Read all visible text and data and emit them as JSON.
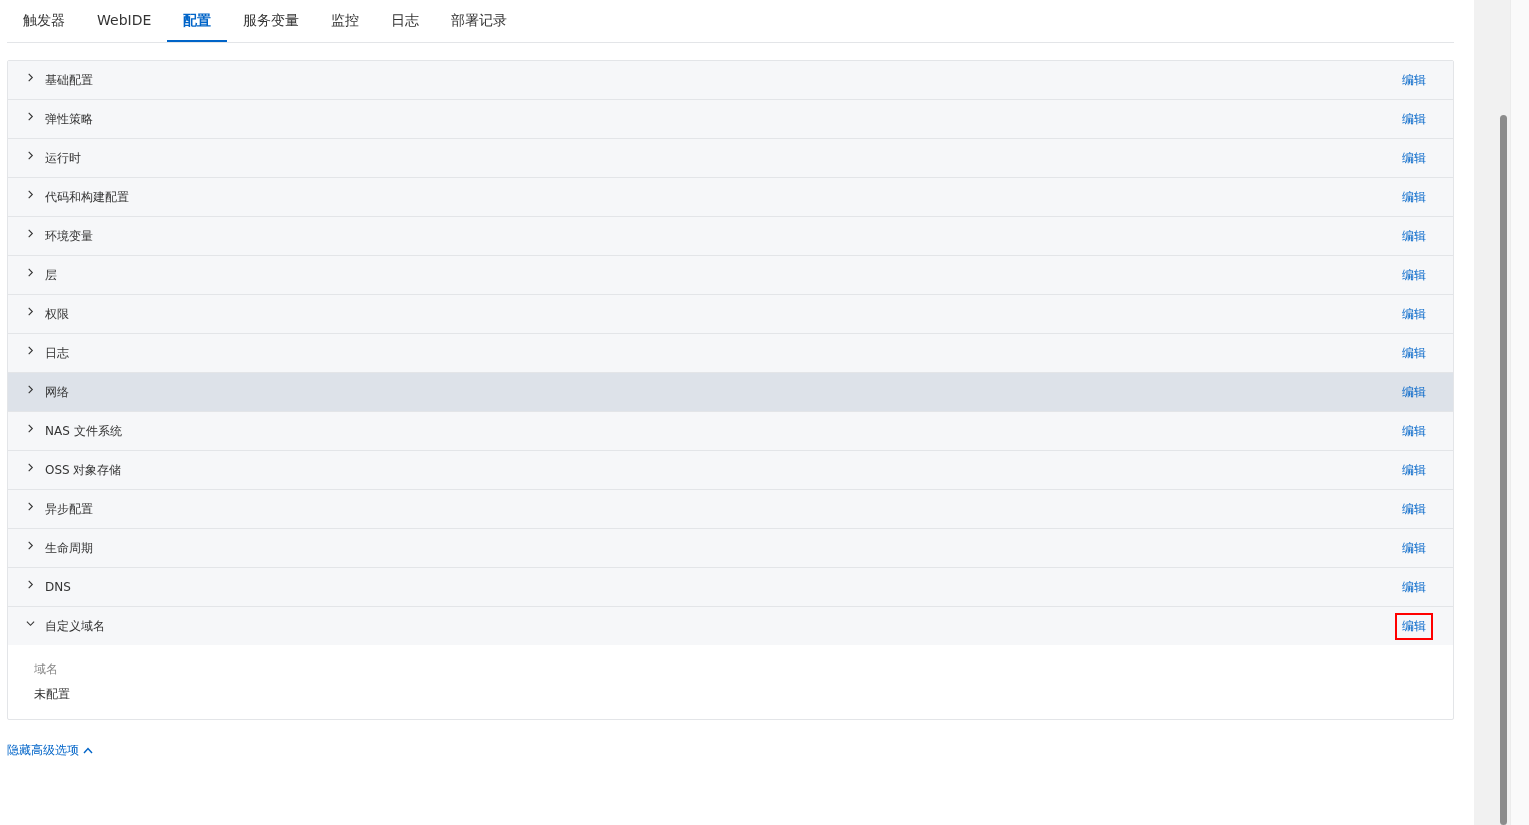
{
  "tabs": [
    {
      "label": "触发器",
      "selected": false
    },
    {
      "label": "WebIDE",
      "selected": false
    },
    {
      "label": "配置",
      "selected": true
    },
    {
      "label": "服务变量",
      "selected": false
    },
    {
      "label": "监控",
      "selected": false
    },
    {
      "label": "日志",
      "selected": false
    },
    {
      "label": "部署记录",
      "selected": false
    }
  ],
  "sections": [
    {
      "title": "基础配置",
      "action": "编辑",
      "expanded": false,
      "hovered": false,
      "highlighted": false
    },
    {
      "title": "弹性策略",
      "action": "编辑",
      "expanded": false,
      "hovered": false,
      "highlighted": false
    },
    {
      "title": "运行时",
      "action": "编辑",
      "expanded": false,
      "hovered": false,
      "highlighted": false
    },
    {
      "title": "代码和构建配置",
      "action": "编辑",
      "expanded": false,
      "hovered": false,
      "highlighted": false
    },
    {
      "title": "环境变量",
      "action": "编辑",
      "expanded": false,
      "hovered": false,
      "highlighted": false
    },
    {
      "title": "层",
      "action": "编辑",
      "expanded": false,
      "hovered": false,
      "highlighted": false
    },
    {
      "title": "权限",
      "action": "编辑",
      "expanded": false,
      "hovered": false,
      "highlighted": false
    },
    {
      "title": "日志",
      "action": "编辑",
      "expanded": false,
      "hovered": false,
      "highlighted": false
    },
    {
      "title": "网络",
      "action": "编辑",
      "expanded": false,
      "hovered": true,
      "highlighted": false
    },
    {
      "title": "NAS 文件系统",
      "action": "编辑",
      "expanded": false,
      "hovered": false,
      "highlighted": false
    },
    {
      "title": "OSS 对象存储",
      "action": "编辑",
      "expanded": false,
      "hovered": false,
      "highlighted": false
    },
    {
      "title": "异步配置",
      "action": "编辑",
      "expanded": false,
      "hovered": false,
      "highlighted": false
    },
    {
      "title": "生命周期",
      "action": "编辑",
      "expanded": false,
      "hovered": false,
      "highlighted": false
    },
    {
      "title": "DNS",
      "action": "编辑",
      "expanded": false,
      "hovered": false,
      "highlighted": false
    },
    {
      "title": "自定义域名",
      "action": "编辑",
      "expanded": true,
      "hovered": false,
      "highlighted": true,
      "fields": [
        {
          "label": "域名",
          "value": "未配置"
        }
      ]
    }
  ],
  "toggle_link": "隐藏高级选项"
}
